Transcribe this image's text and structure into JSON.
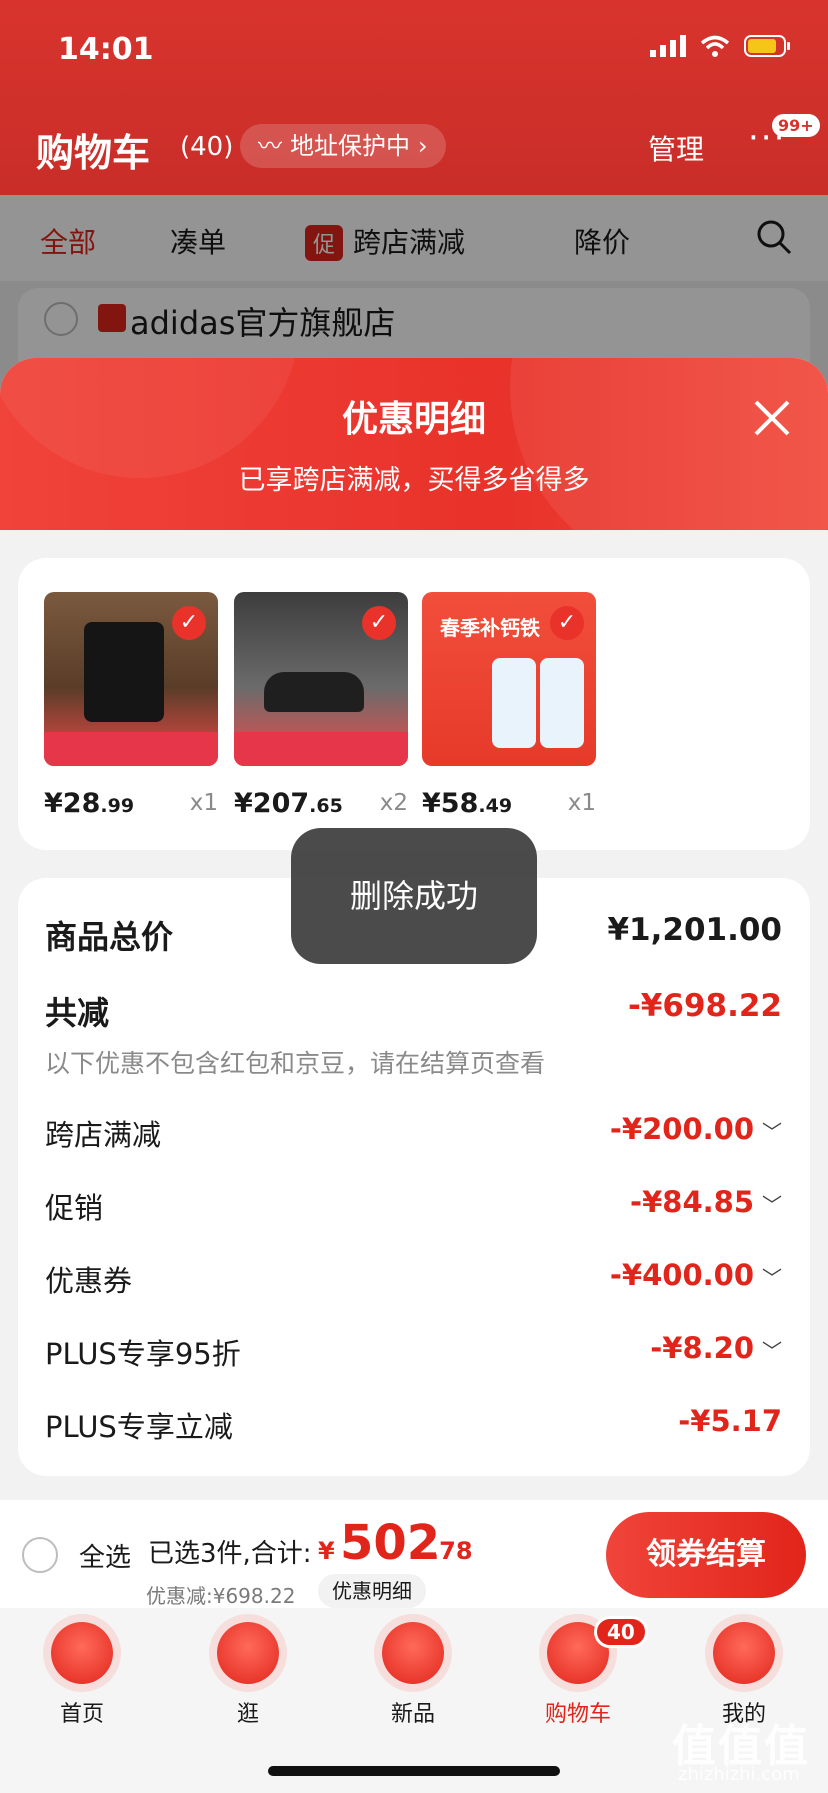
{
  "status_bar": {
    "time": "14:01"
  },
  "header": {
    "title": "购物车",
    "count": "(40)",
    "address_protect": "地址保护中",
    "manage": "管理",
    "more": "···",
    "more_badge": "99+"
  },
  "tabs": [
    {
      "label": "全部"
    },
    {
      "label": "凑单"
    },
    {
      "label": "跨店满减",
      "tag": "促"
    },
    {
      "label": "降价"
    }
  ],
  "store": {
    "name": "adidas官方旗舰店"
  },
  "modal": {
    "title": "优惠明细",
    "subtitle": "已享跨店满减，买得多省得多"
  },
  "products": [
    {
      "price_int": "¥28",
      "price_dec": ".99",
      "qty": "x1"
    },
    {
      "price_int": "¥207",
      "price_dec": ".65",
      "qty": "x2"
    },
    {
      "price_int": "¥58",
      "price_dec": ".49",
      "qty": "x1",
      "img_text": "春季补钙铁"
    }
  ],
  "summary": {
    "total_label": "商品总价",
    "total_value": "¥1,201.00",
    "reduce_label": "共减",
    "reduce_value": "-¥698.22",
    "note": "以下优惠不包含红包和京豆，请在结算页查看",
    "items": [
      {
        "label": "跨店满减",
        "value": "-¥200.00"
      },
      {
        "label": "促销",
        "value": "-¥84.85"
      },
      {
        "label": "优惠券",
        "value": "-¥400.00"
      },
      {
        "label": "PLUS专享95折",
        "value": "-¥8.20"
      },
      {
        "label": "PLUS专享立减",
        "value": "-¥5.17"
      }
    ]
  },
  "toast": "删除成功",
  "bottom": {
    "select_all": "全选",
    "selected_text": "已选3件,合计:",
    "currency": "¥",
    "total_int": "502",
    "total_dec": ".78",
    "discount": "优惠减:¥698.22",
    "detail": "优惠明细",
    "checkout": "领券结算"
  },
  "tabbar": [
    {
      "label": "首页"
    },
    {
      "label": "逛"
    },
    {
      "label": "新品"
    },
    {
      "label": "购物车",
      "badge": "40"
    },
    {
      "label": "我的"
    }
  ],
  "watermark": {
    "main": "值值值",
    "url": "zhizhizhi.com"
  },
  "colors": {
    "accent": "#e1251b"
  }
}
